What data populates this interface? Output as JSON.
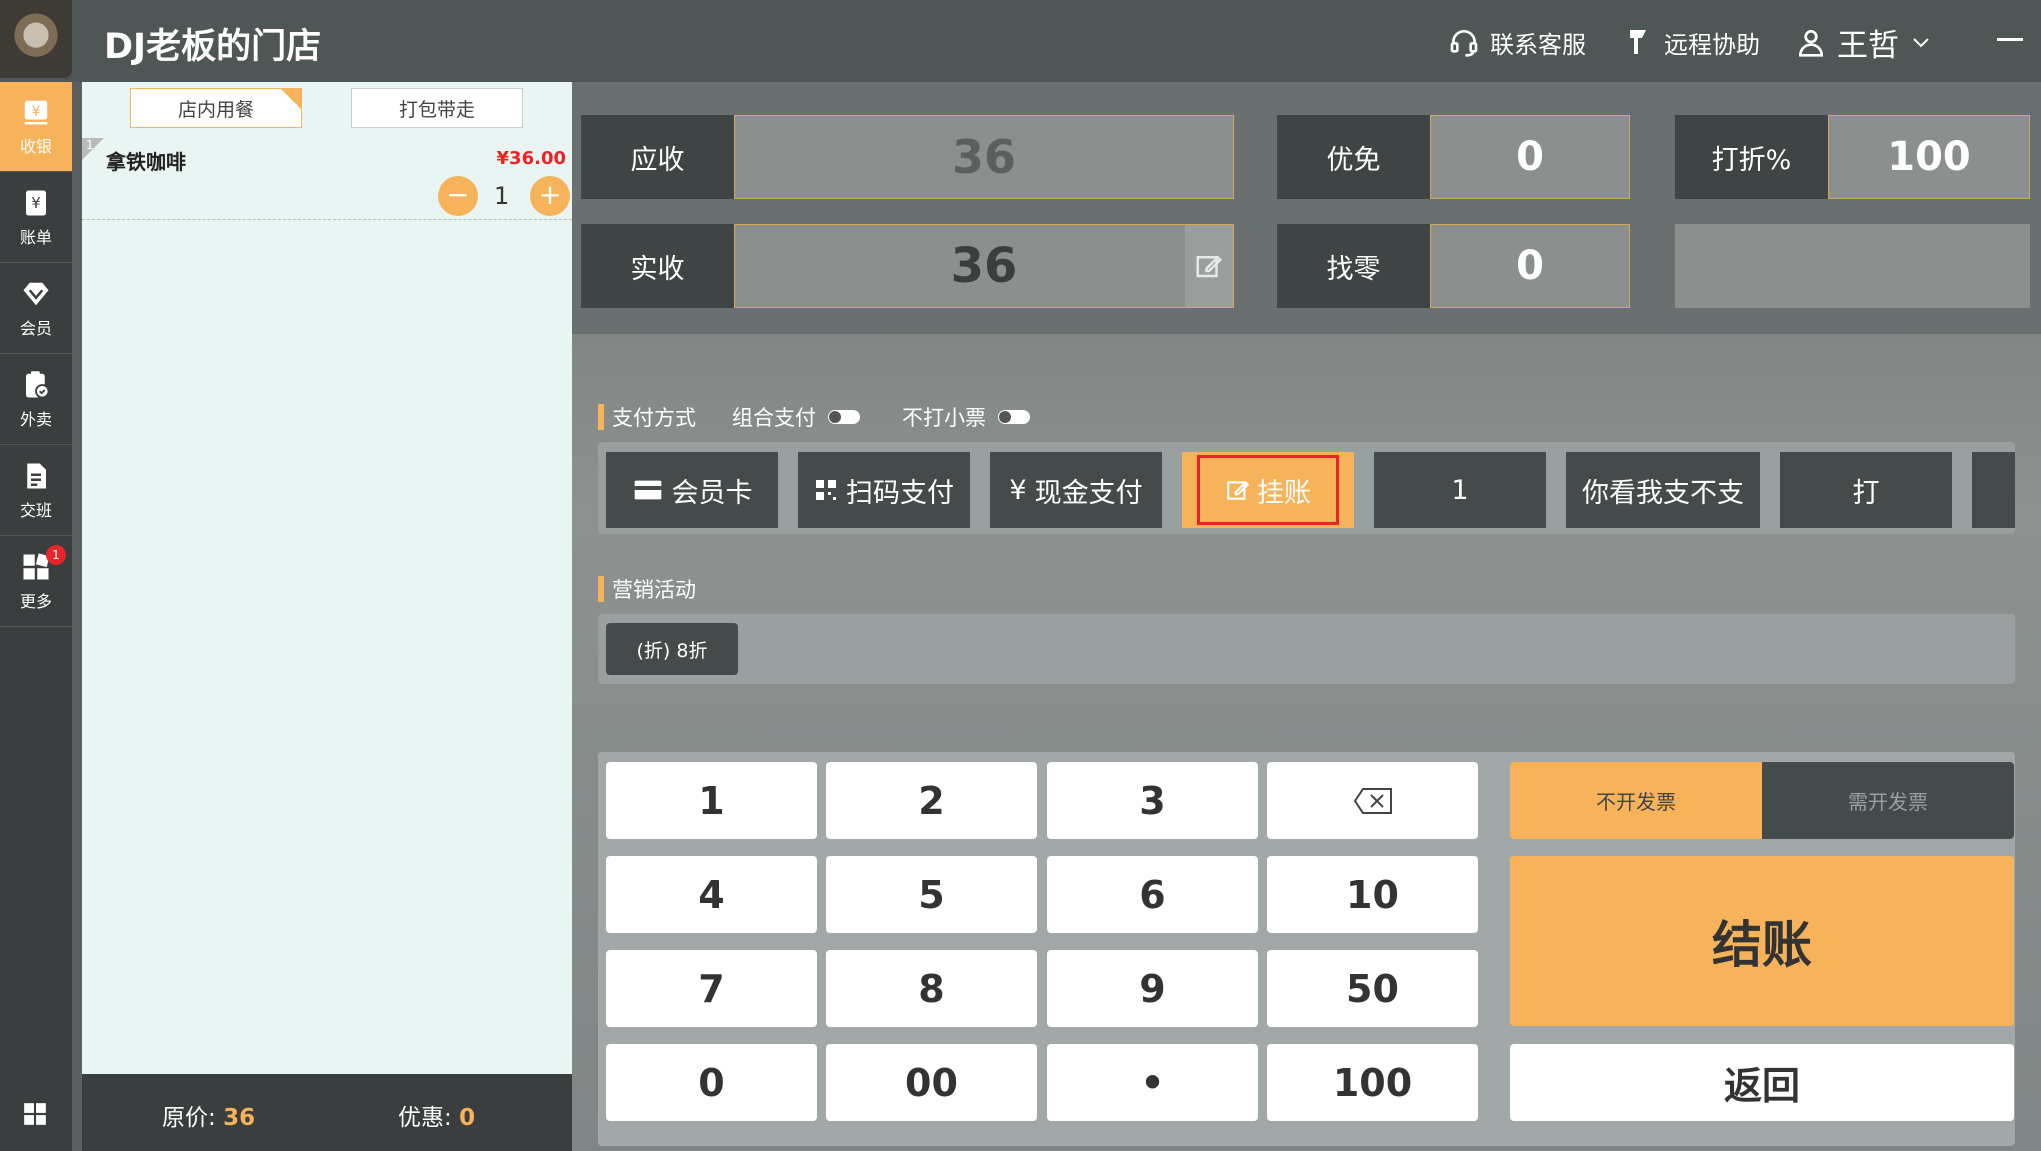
{
  "header": {
    "store_name": "DJ老板的门店",
    "support_label": "联系客服",
    "remote_label": "远程协助",
    "user_name": "王哲"
  },
  "sidebar": {
    "items": [
      {
        "label": "收银",
        "icon": "cashier-icon",
        "active": true
      },
      {
        "label": "账单",
        "icon": "bill-icon"
      },
      {
        "label": "会员",
        "icon": "member-icon"
      },
      {
        "label": "外卖",
        "icon": "takeout-icon"
      },
      {
        "label": "交班",
        "icon": "shift-icon"
      },
      {
        "label": "更多",
        "icon": "more-icon",
        "badge": "1"
      }
    ]
  },
  "order": {
    "tabs": [
      "店内用餐",
      "打包带走"
    ],
    "selected_tab": 0,
    "lines": [
      {
        "no": "1",
        "name": "拿铁咖啡",
        "price": "¥36.00",
        "qty": "1"
      }
    ],
    "footer": {
      "original_label": "原价:",
      "original_value": "36",
      "discount_label": "优惠:",
      "discount_value": "0"
    }
  },
  "stats": {
    "receivable_label": "应收",
    "receivable_value": "36",
    "waive_label": "优免",
    "waive_value": "0",
    "discount_label": "打折%",
    "discount_value": "100",
    "received_label": "实收",
    "received_value": "36",
    "change_label": "找零",
    "change_value": "0"
  },
  "payment": {
    "section_title": "支付方式",
    "combo_label": "组合支付",
    "no_receipt_label": "不打小票",
    "methods": [
      "会员卡",
      "扫码支付",
      "现金支付",
      "挂账",
      "1",
      "你看我支不支",
      "打"
    ],
    "selected": "挂账",
    "cash_prefix": "¥"
  },
  "marketing": {
    "section_title": "营销活动",
    "promos": [
      "(折) 8折"
    ]
  },
  "keypad": {
    "keys": [
      "1",
      "2",
      "3",
      "",
      "4",
      "5",
      "6",
      "10",
      "7",
      "8",
      "9",
      "50",
      "0",
      "00",
      "•",
      "100"
    ],
    "no_invoice_label": "不开发票",
    "need_invoice_label": "需开发票",
    "checkout_label": "结账",
    "back_label": "返回"
  },
  "colors": {
    "accent": "#f6b35a",
    "dark": "#3f4545",
    "price_red": "#e22222",
    "highlight_border": "#e8262a"
  }
}
